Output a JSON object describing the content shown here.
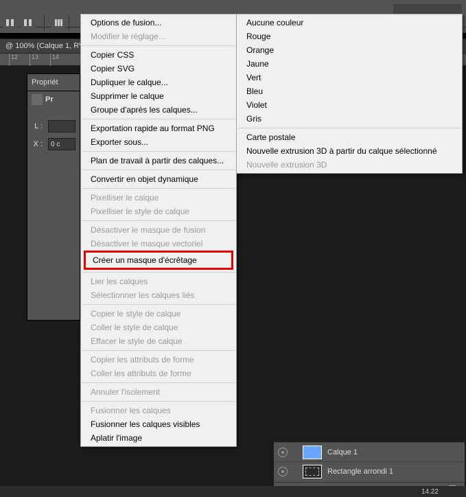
{
  "topbar": {
    "doc_tab": "@ 100% (Calque 1, RVB"
  },
  "ruler": {
    "ticks": [
      12,
      13,
      14
    ]
  },
  "properties": {
    "title": "Propriét",
    "prefix_label": "Pr",
    "L_label": "L :",
    "X_label": "X :",
    "X_value": "0 c"
  },
  "menu": {
    "items": [
      {
        "label": "Options de fusion...",
        "disabled": false
      },
      {
        "label": "Modifier le réglage…",
        "disabled": true
      },
      {
        "sep": true
      },
      {
        "label": "Copier CSS",
        "disabled": false
      },
      {
        "label": "Copier SVG",
        "disabled": false
      },
      {
        "label": "Dupliquer le calque...",
        "disabled": false
      },
      {
        "label": "Supprimer le calque",
        "disabled": false
      },
      {
        "label": "Groupe d'après les calques...",
        "disabled": false
      },
      {
        "sep": true
      },
      {
        "label": "Exportation rapide au format PNG",
        "disabled": false
      },
      {
        "label": "Exporter sous...",
        "disabled": false
      },
      {
        "sep": true
      },
      {
        "label": "Plan de travail à partir des calques...",
        "disabled": false
      },
      {
        "sep": true
      },
      {
        "label": "Convertir en objet dynamique",
        "disabled": false
      },
      {
        "sep": true
      },
      {
        "label": "Pixelliser le calque",
        "disabled": true
      },
      {
        "label": "Pixelliser le style de calque",
        "disabled": true
      },
      {
        "sep": true
      },
      {
        "label": "Désactiver le masque de fusion",
        "disabled": true
      },
      {
        "label": "Désactiver le masque vectoriel",
        "disabled": true
      },
      {
        "label": "Créer un masque d'écrêtage",
        "disabled": false,
        "hl": true
      },
      {
        "sep": true
      },
      {
        "label": "Lier les calques",
        "disabled": true
      },
      {
        "label": "Sélectionner les calques liés",
        "disabled": true
      },
      {
        "sep": true
      },
      {
        "label": "Copier le style de calque",
        "disabled": true
      },
      {
        "label": "Coller le style de calque",
        "disabled": true
      },
      {
        "label": "Effacer le style de calque",
        "disabled": true
      },
      {
        "sep": true
      },
      {
        "label": "Copier les attributs de forme",
        "disabled": true
      },
      {
        "label": "Coller les attributs de forme",
        "disabled": true
      },
      {
        "sep": true
      },
      {
        "label": "Annuler l'isolement",
        "disabled": true
      },
      {
        "sep": true
      },
      {
        "label": "Fusionner les calques",
        "disabled": true
      },
      {
        "label": "Fusionner les calques visibles",
        "disabled": false
      },
      {
        "label": "Aplatir l'image",
        "disabled": false
      }
    ]
  },
  "submenu": {
    "items": [
      {
        "label": "Aucune couleur",
        "disabled": false
      },
      {
        "label": "Rouge",
        "disabled": false
      },
      {
        "label": "Orange",
        "disabled": false
      },
      {
        "label": "Jaune",
        "disabled": false
      },
      {
        "label": "Vert",
        "disabled": false
      },
      {
        "label": "Bleu",
        "disabled": false
      },
      {
        "label": "Violet",
        "disabled": false
      },
      {
        "label": "Gris",
        "disabled": false
      },
      {
        "sep": true
      },
      {
        "label": "Carte postale",
        "disabled": false
      },
      {
        "label": "Nouvelle extrusion 3D à partir du calque sélectionné",
        "disabled": false
      },
      {
        "label": "Nouvelle extrusion 3D",
        "disabled": true
      }
    ]
  },
  "layers": {
    "rows": [
      {
        "name": "Calque 1"
      },
      {
        "name": "Rectangle arrondi 1"
      }
    ]
  },
  "status": {
    "time_partial": "14.22"
  }
}
